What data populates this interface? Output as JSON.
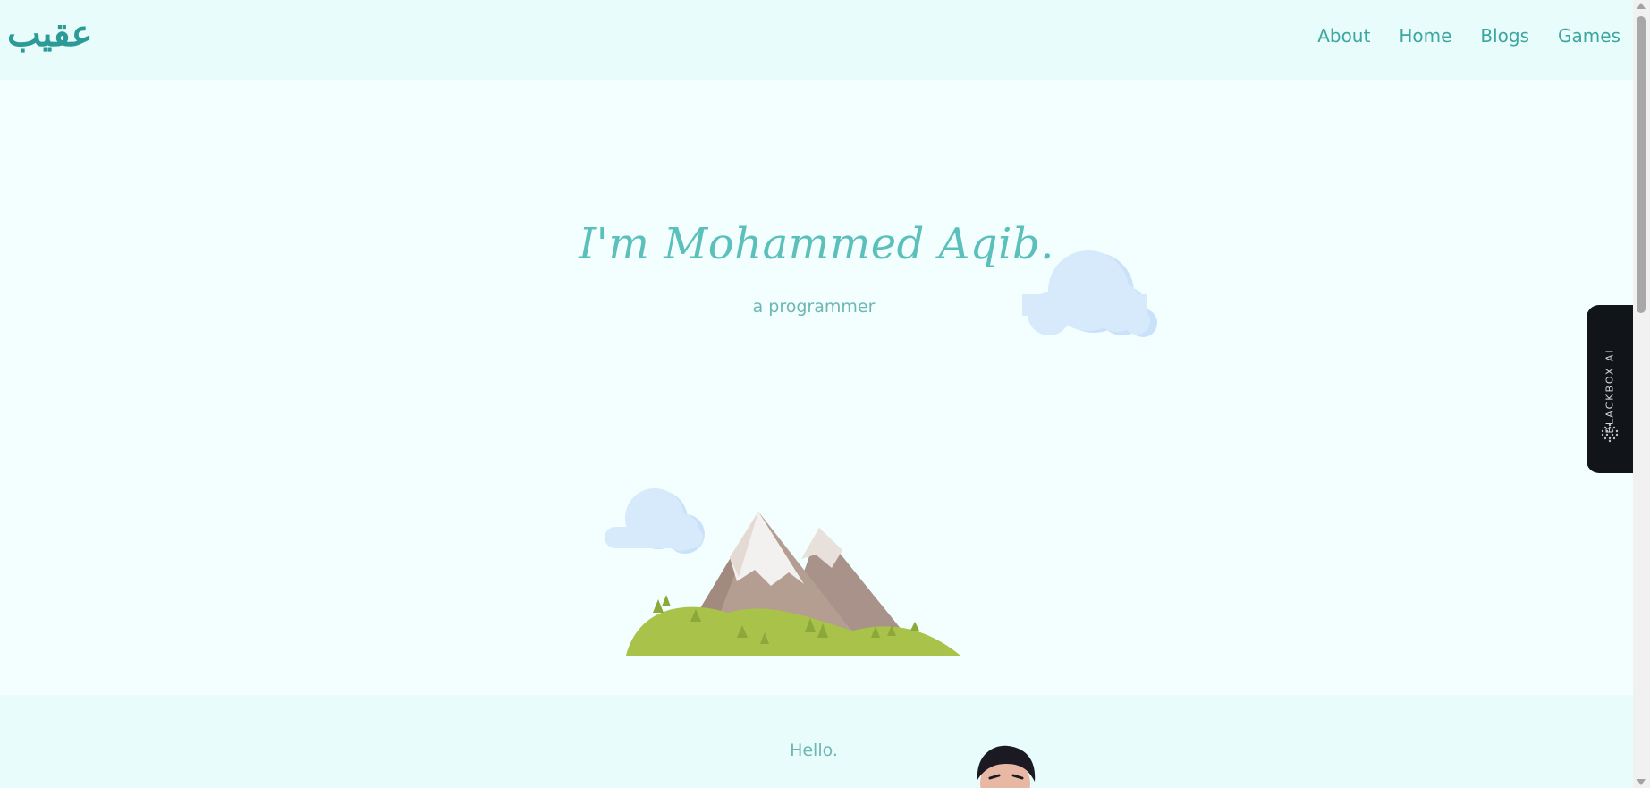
{
  "header": {
    "logo_text": "عقيب",
    "nav": [
      "About",
      "Home",
      "Blogs",
      "Games"
    ]
  },
  "hero": {
    "title": "I'm Mohammed Aqib.",
    "subtitle_prefix": "a",
    "subtitle_typed": "pro",
    "subtitle_rest": "grammer"
  },
  "about": {
    "greeting": "Hello."
  },
  "blackbox": {
    "label": "BLACKBOX AI"
  },
  "colors": {
    "accent": "#3ea6a0",
    "title": "#5bbfbb",
    "header_bg": "#e8fcfb",
    "page_bg": "#f2fffe",
    "cloud": "#d4e9fb"
  },
  "icons": [
    "cloud-icon",
    "mountain-illustration",
    "avatar",
    "blackbox-dots-icon"
  ]
}
